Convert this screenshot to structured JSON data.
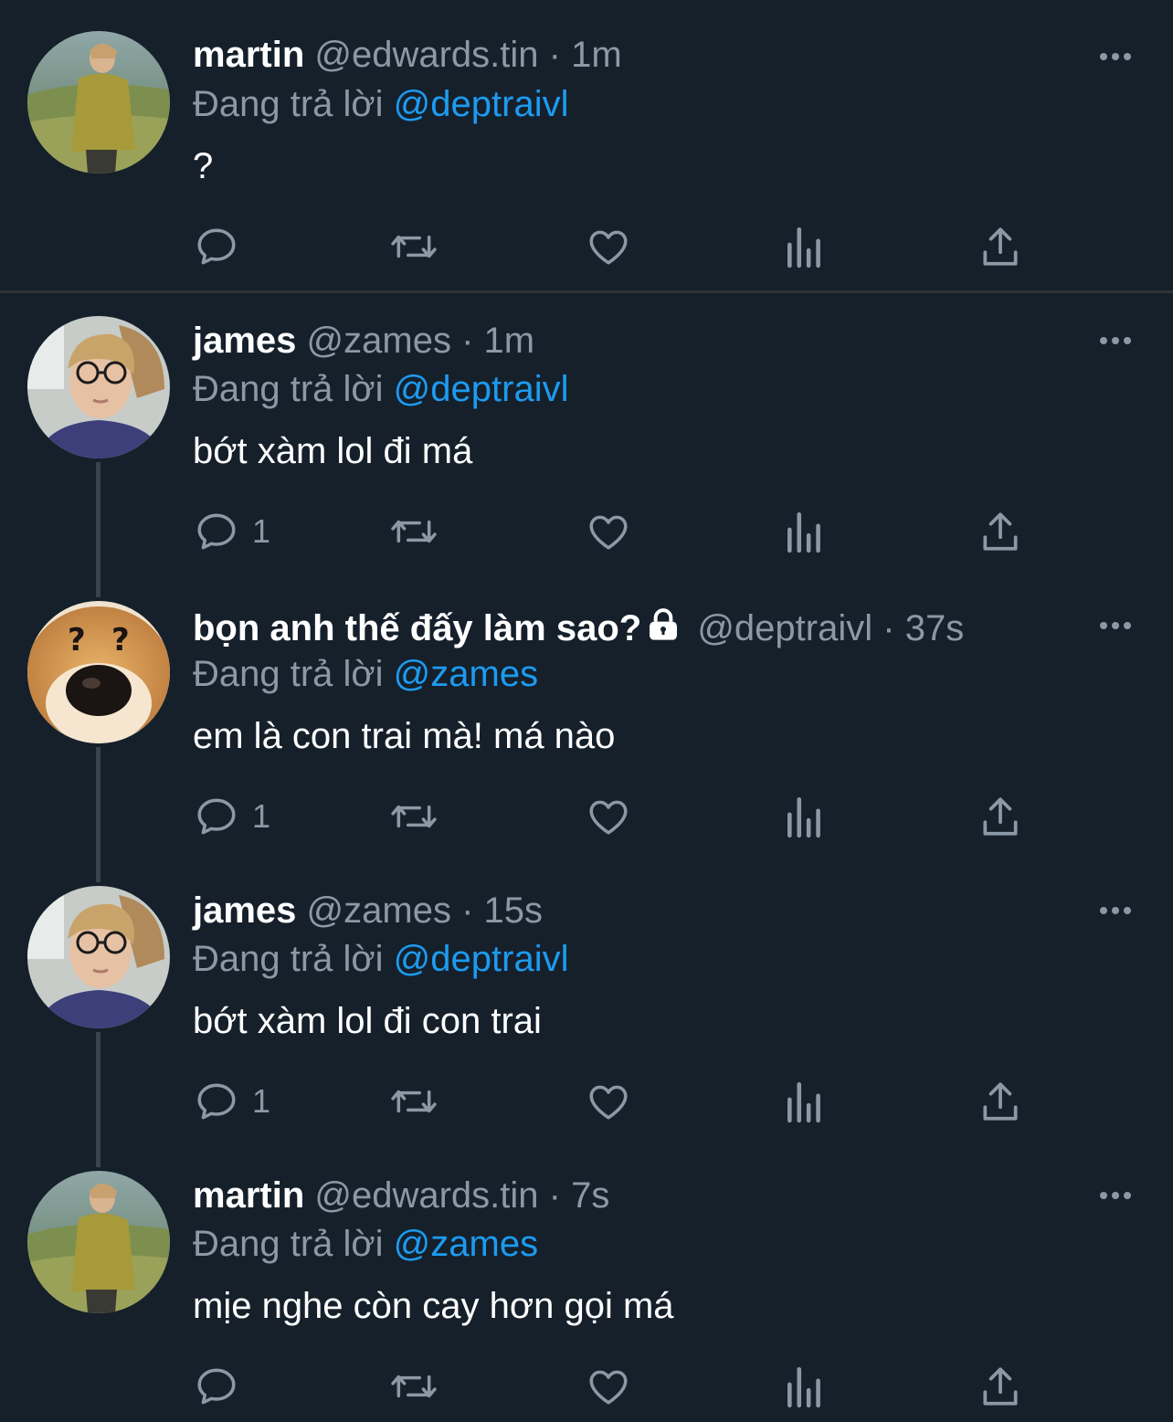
{
  "colors": {
    "background": "#15202b",
    "secondary_text": "#8b98a5",
    "link": "#1d9bf0",
    "primary_text": "#ffffff"
  },
  "replying_prefix": "Đang trả lời",
  "tweets": [
    {
      "name": "martin",
      "handle": "@edwards.tin",
      "separator": "·",
      "time": "1m",
      "reply_to": "@deptraivl",
      "text": "?",
      "reply_count": "",
      "avatar": "avatar-martin-photo"
    },
    {
      "name": "james",
      "handle": "@zames",
      "separator": "·",
      "time": "1m",
      "reply_to": "@deptraivl",
      "text": "bớt xàm lol đi má",
      "reply_count": "1",
      "avatar": "avatar-james-photo"
    },
    {
      "name": "bọn anh thế đấy làm sao?",
      "handle": "@deptraivl",
      "separator": "·",
      "time": "37s",
      "reply_to": "@zames",
      "text": "em là con trai mà! má nào",
      "reply_count": "1",
      "protected": true,
      "avatar": "avatar-dog-question"
    },
    {
      "name": "james",
      "handle": "@zames",
      "separator": "·",
      "time": "15s",
      "reply_to": "@deptraivl",
      "text": "bớt xàm lol đi con trai",
      "reply_count": "1",
      "avatar": "avatar-james-photo"
    },
    {
      "name": "martin",
      "handle": "@edwards.tin",
      "separator": "·",
      "time": "7s",
      "reply_to": "@zames",
      "text": "mịe nghe còn cay hơn gọi má",
      "reply_count": "",
      "avatar": "avatar-martin-photo"
    }
  ],
  "icons": {
    "reply": "reply-icon",
    "retweet": "retweet-icon",
    "like": "like-icon",
    "views": "views-icon",
    "share": "share-icon",
    "more": "more-icon",
    "lock": "lock-icon"
  }
}
